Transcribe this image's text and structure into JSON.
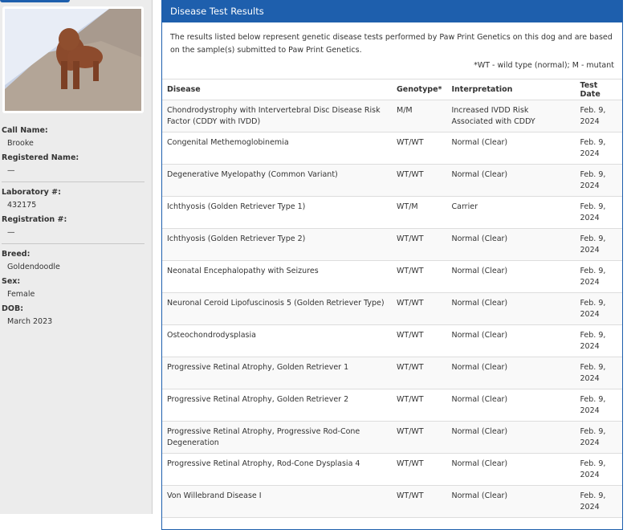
{
  "sidebar": {
    "fields": [
      {
        "label": "Call Name:",
        "value": "Brooke"
      },
      {
        "label": "Registered Name:",
        "value": "—"
      },
      {
        "label": "Laboratory #:",
        "value": "432175"
      },
      {
        "label": "Registration #:",
        "value": "—"
      },
      {
        "label": "Breed:",
        "value": "Goldendoodle"
      },
      {
        "label": "Sex:",
        "value": "Female"
      },
      {
        "label": "DOB:",
        "value": "March 2023"
      }
    ]
  },
  "panel": {
    "title": "Disease Test Results",
    "intro": "The results listed below represent genetic disease tests performed by Paw Print Genetics on this dog and are based on the sample(s) submitted to Paw Print Genetics.",
    "legend": "*WT - wild type (normal); M - mutant",
    "columns": [
      "Disease",
      "Genotype*",
      "Interpretation",
      "Test Date"
    ],
    "rows": [
      [
        "Chondrodystrophy with Intervertebral Disc Disease Risk Factor (CDDY with IVDD)",
        "M/M",
        "Increased IVDD Risk Associated with CDDY",
        "Feb. 9, 2024"
      ],
      [
        "Congenital Methemoglobinemia",
        "WT/WT",
        "Normal (Clear)",
        "Feb. 9, 2024"
      ],
      [
        "Degenerative Myelopathy (Common Variant)",
        "WT/WT",
        "Normal (Clear)",
        "Feb. 9, 2024"
      ],
      [
        "Ichthyosis (Golden Retriever Type 1)",
        "WT/M",
        "Carrier",
        "Feb. 9, 2024"
      ],
      [
        "Ichthyosis (Golden Retriever Type 2)",
        "WT/WT",
        "Normal (Clear)",
        "Feb. 9, 2024"
      ],
      [
        "Neonatal Encephalopathy with Seizures",
        "WT/WT",
        "Normal (Clear)",
        "Feb. 9, 2024"
      ],
      [
        "Neuronal Ceroid Lipofuscinosis 5 (Golden Retriever Type)",
        "WT/WT",
        "Normal (Clear)",
        "Feb. 9, 2024"
      ],
      [
        "Osteochondrodysplasia",
        "WT/WT",
        "Normal (Clear)",
        "Feb. 9, 2024"
      ],
      [
        "Progressive Retinal Atrophy, Golden Retriever 1",
        "WT/WT",
        "Normal (Clear)",
        "Feb. 9, 2024"
      ],
      [
        "Progressive Retinal Atrophy, Golden Retriever 2",
        "WT/WT",
        "Normal (Clear)",
        "Feb. 9, 2024"
      ],
      [
        "Progressive Retinal Atrophy, Progressive Rod-Cone Degeneration",
        "WT/WT",
        "Normal (Clear)",
        "Feb. 9, 2024"
      ],
      [
        "Progressive Retinal Atrophy, Rod-Cone Dysplasia 4",
        "WT/WT",
        "Normal (Clear)",
        "Feb. 9, 2024"
      ],
      [
        "Von Willebrand Disease I",
        "WT/WT",
        "Normal (Clear)",
        "Feb. 9, 2024"
      ]
    ]
  }
}
